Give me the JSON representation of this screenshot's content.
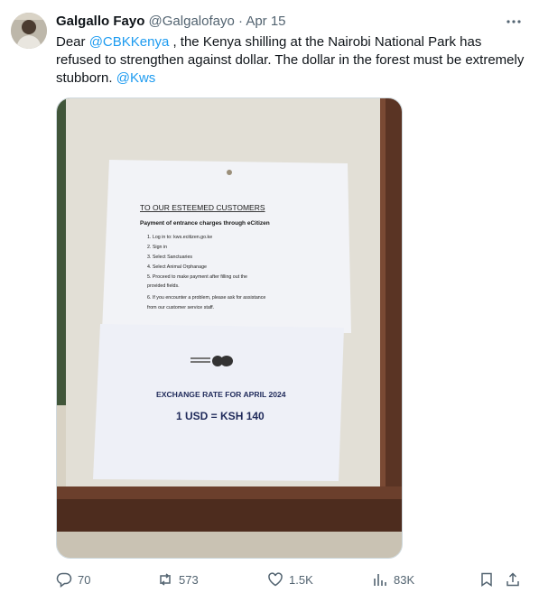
{
  "author": {
    "name": "Galgallo Fayo",
    "handle": "@Galgalofayo",
    "separator": "·",
    "date": "Apr 15"
  },
  "tweet": {
    "text_part1": "Dear ",
    "mention1": "@CBKKenya",
    "text_part2": " , the Kenya shilling at the Nairobi National Park has refused to strengthen against dollar. The dollar in the forest must be extremely stubborn. ",
    "mention2": "@Kws"
  },
  "photo": {
    "notice_title": "TO OUR ESTEEMED CUSTOMERS",
    "notice_subtitle": "Payment of entrance charges through eCitizen",
    "steps": [
      "1.  Log in to: kws.ecitizen.go.ke",
      "2.  Sign in",
      "3.  Select Sanctuaries",
      "4.  Select Animal Orphanage",
      "5.  Proceed to make payment after filling out the",
      "     provided fields.",
      "6.  If you encounter a problem, please ask for assistance",
      "     from our customer service staff."
    ],
    "rate_title": "EXCHANGE RATE FOR APRIL 2024",
    "rate_value": "1 USD = KSH 140"
  },
  "actions": {
    "replies": "70",
    "reposts": "573",
    "likes": "1.5K",
    "views": "83K"
  },
  "icons": [
    "more-icon",
    "reply-icon",
    "repost-icon",
    "like-icon",
    "views-icon",
    "bookmark-icon",
    "share-icon"
  ],
  "colors": {
    "link": "#1d9bf0",
    "secondary": "#536471",
    "text": "#0f1419"
  }
}
